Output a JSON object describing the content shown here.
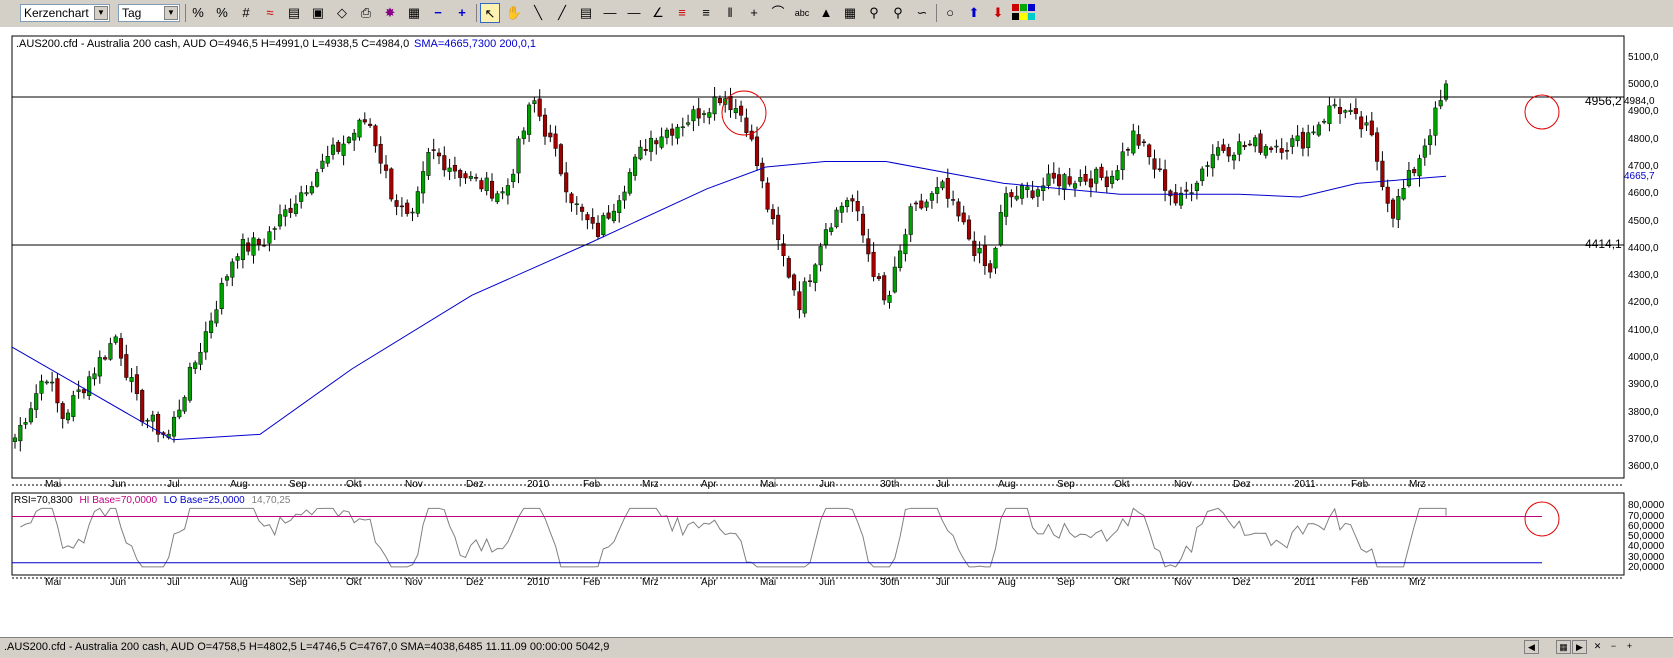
{
  "toolbar": {
    "chart_type": "Kerzenchart",
    "period": "Tag",
    "text_tool_label": "abc"
  },
  "main_chart": {
    "header": ".AUS200.cfd - Australia 200 cash, AUD O=4946,5 H=4991,0 L=4938,5 C=4984,0",
    "sma_label": "SMA=4665,7300  200,0,1",
    "y_ticks": [
      "5100,0",
      "5000,0",
      "4900,0",
      "4800,0",
      "4700,0",
      "4600,0",
      "4500,0",
      "4400,0",
      "4300,0",
      "4200,0",
      "4100,0",
      "4000,0",
      "3900,0",
      "3800,0",
      "3700,0",
      "3600,0"
    ],
    "resistance_label": "4956,2",
    "last_price_label": "4984,0",
    "support_label": "4414,1",
    "sma_value_label": "4665,7"
  },
  "x_labels": [
    "Mai",
    "Jun",
    "Jul",
    "Aug",
    "Sep",
    "Okt",
    "Nov",
    "Dez",
    "2010",
    "Feb",
    "Mrz",
    "Apr",
    "Mai",
    "Jun",
    "30th",
    "Jul",
    "Aug",
    "Sep",
    "Okt",
    "Nov",
    "Dez",
    "2011",
    "Feb",
    "Mrz"
  ],
  "rsi_panel": {
    "header_rsi": "RSI=70,8300",
    "header_hi": "HI Base=70,0000",
    "header_lo": "LO Base=25,0000",
    "header_params": "14,70,25",
    "y_ticks": [
      "80,0000",
      "70,0000",
      "60,0000",
      "50,0000",
      "40,0000",
      "30,0000",
      "20,0000"
    ]
  },
  "status_bar": {
    "text": ".AUS200.cfd - Australia 200 cash, AUD O=4758,5 H=4802,5 L=4746,5 C=4767,0  SMA=4038,6485  11.11.09 00:00:00 5042,9"
  },
  "colors": {
    "up_candle": "#00a000",
    "down_candle": "#a00000",
    "sma": "#0000cc",
    "rsi": "#808080",
    "hi_base": "#c00080",
    "lo_base": "#0000cc",
    "highlight_circle": "#e00000"
  },
  "chart_data": {
    "type": "candlestick",
    "title": ".AUS200.cfd - Australia 200 cash, AUD",
    "ylim": [
      3560,
      5180
    ],
    "price_path": [
      [
        "Apr 2009",
        3700
      ],
      [
        "Mai",
        3950
      ],
      [
        "Mai",
        3780
      ],
      [
        "Jun",
        4080
      ],
      [
        "Jun",
        3800
      ],
      [
        "Jul",
        3710
      ],
      [
        "Aug",
        4400
      ],
      [
        "Aug",
        4420
      ],
      [
        "Sep",
        4700
      ],
      [
        "Okt",
        4880
      ],
      [
        "Okt",
        4600
      ],
      [
        "Nov",
        4480
      ],
      [
        "Nov",
        4760
      ],
      [
        "Dez",
        4650
      ],
      [
        "Dez",
        4600
      ],
      [
        "2010",
        4950
      ],
      [
        "Feb",
        4560
      ],
      [
        "Feb",
        4450
      ],
      [
        "Mrz",
        4800
      ],
      [
        "Mrz",
        4880
      ],
      [
        "Apr",
        4970
      ],
      [
        "Apr",
        4880
      ],
      [
        "Mai",
        4450
      ],
      [
        "Mai",
        4200
      ],
      [
        "Jun",
        4480
      ],
      [
        "Jun",
        4600
      ],
      [
        "30th",
        4180
      ],
      [
        "Jul",
        4520
      ],
      [
        "Jul",
        4620
      ],
      [
        "Aug",
        4300
      ],
      [
        "Aug",
        4580
      ],
      [
        "Sep",
        4660
      ],
      [
        "Okt",
        4660
      ],
      [
        "Okt",
        4820
      ],
      [
        "Nov",
        4560
      ],
      [
        "Dez",
        4770
      ],
      [
        "2011",
        4790
      ],
      [
        "2011",
        4930
      ],
      [
        "Feb",
        4820
      ],
      [
        "Feb",
        4530
      ],
      [
        "Mrz",
        4700
      ],
      [
        "Mrz",
        4984
      ]
    ],
    "sma_200": [
      [
        "Apr 2009",
        4040
      ],
      [
        "Jul",
        3700
      ],
      [
        "Aug",
        3720
      ],
      [
        "Okt",
        3960
      ],
      [
        "Dez",
        4230
      ],
      [
        "Feb",
        4420
      ],
      [
        "Apr",
        4620
      ],
      [
        "Mai",
        4700
      ],
      [
        "Jun",
        4720
      ],
      [
        "30th",
        4720
      ],
      [
        "Aug",
        4640
      ],
      [
        "Okt",
        4600
      ],
      [
        "Dez",
        4600
      ],
      [
        "2011",
        4590
      ],
      [
        "Feb",
        4640
      ],
      [
        "Mrz",
        4666
      ]
    ],
    "horizontal_lines": [
      4956.2,
      4414.1
    ],
    "rsi": {
      "ylim": [
        15,
        90
      ],
      "hi_base": 70,
      "lo_base": 25,
      "last": 70.83
    }
  }
}
